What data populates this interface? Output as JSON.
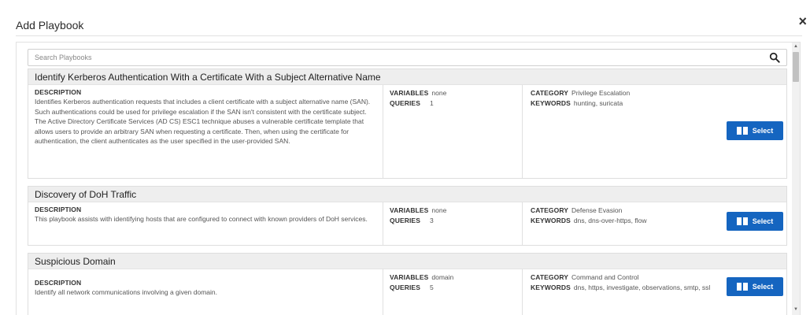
{
  "modal": {
    "title": "Add Playbook",
    "close_label": "×"
  },
  "search": {
    "placeholder": "Search Playbooks",
    "icon": "search-icon"
  },
  "labels": {
    "description": "DESCRIPTION",
    "variables": "VARIABLES",
    "queries": "QUERIES",
    "category": "CATEGORY",
    "keywords": "KEYWORDS"
  },
  "select_label": "Select",
  "playbooks": [
    {
      "title": "Identify Kerberos Authentication With a Certificate With a Subject Alternative Name",
      "description": "Identifies Kerberos authentication requests that includes a client certificate with a subject alternative name (SAN). Such authentications could be used for privilege escalation if the SAN isn't consistent with the certificate subject. The Active Directory Certificate Services (AD CS) ESC1 technique abuses a vulnerable certificate template that allows users to provide an arbitrary SAN when requesting a certificate. Then, when using the certificate for authentication, the client authenticates as the user specified in the user-provided SAN.",
      "variables": "none",
      "queries": "1",
      "category": "Privilege Escalation",
      "keywords": "hunting, suricata"
    },
    {
      "title": "Discovery of DoH Traffic",
      "description": "This playbook assists with identifying hosts that are configured to connect with known providers of DoH services.",
      "variables": "none",
      "queries": "3",
      "category": "Defense Evasion",
      "keywords": "dns, dns-over-https, flow"
    },
    {
      "title": "Suspicious Domain",
      "description": "Identify all network communications involving a given domain.",
      "variables": "domain",
      "queries": "5",
      "category": "Command and Control",
      "keywords": "dns, https, investigate, observations, smtp, ssl"
    }
  ],
  "colors": {
    "accent": "#1565c0",
    "card_header": "#eeeeee"
  }
}
